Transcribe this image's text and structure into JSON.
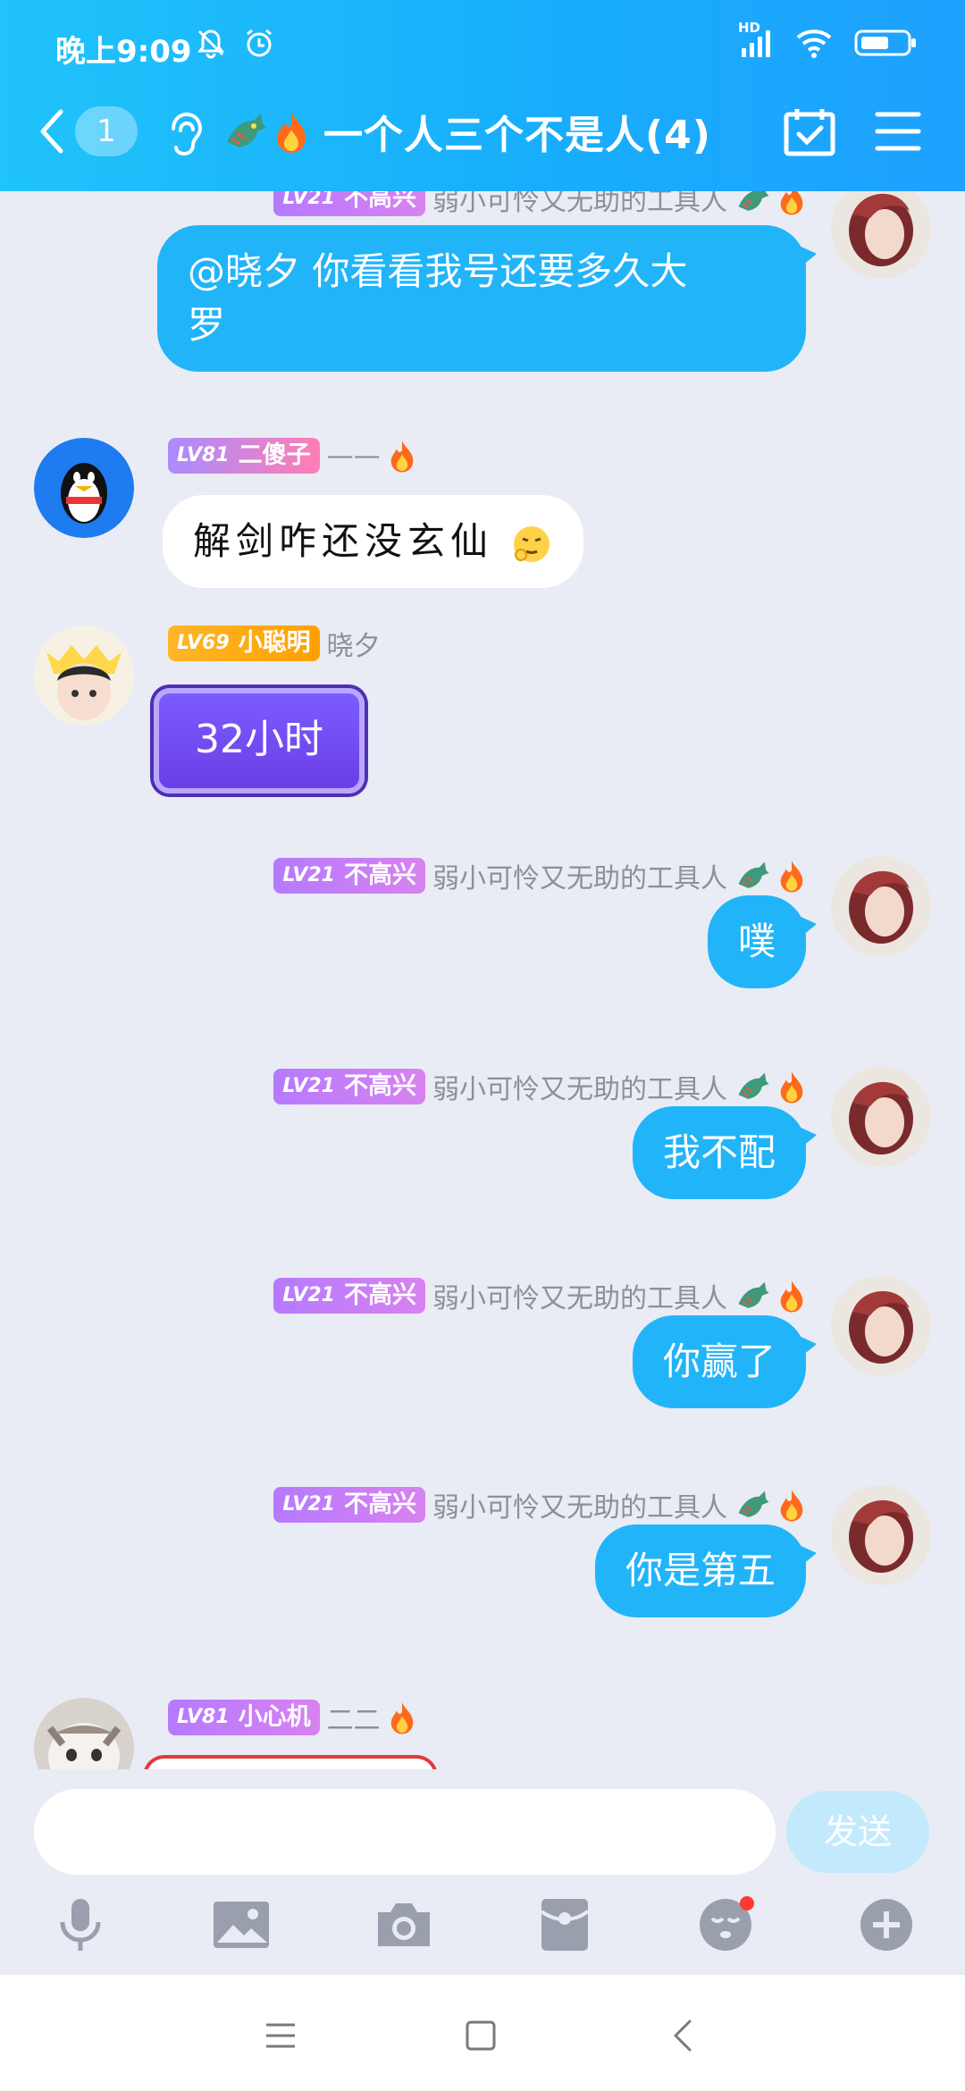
{
  "status_bar": {
    "time": "晚上9:09",
    "hd": "HD"
  },
  "title_bar": {
    "unread_count": "1",
    "title": "一个人三个不是人(4)"
  },
  "messages": [
    {
      "direction": "out",
      "level": "LV21",
      "title_badge": "不高兴",
      "nickname": "弱小可怜又无助的工具人",
      "text": "@晓夕 你看看我号还要多久大\n罗"
    },
    {
      "direction": "in",
      "level": "LV81",
      "title_badge": "二傻子",
      "nickname": "——",
      "text": "解剑咋还没玄仙"
    },
    {
      "direction": "in",
      "level": "LV69",
      "title_badge": "小聪明",
      "nickname": "晓夕",
      "text": "32小时"
    },
    {
      "direction": "out",
      "level": "LV21",
      "title_badge": "不高兴",
      "nickname": "弱小可怜又无助的工具人",
      "text": "噗"
    },
    {
      "direction": "out",
      "level": "LV21",
      "title_badge": "不高兴",
      "nickname": "弱小可怜又无助的工具人",
      "text": "我不配"
    },
    {
      "direction": "out",
      "level": "LV21",
      "title_badge": "不高兴",
      "nickname": "弱小可怜又无助的工具人",
      "text": "你赢了"
    },
    {
      "direction": "out",
      "level": "LV21",
      "title_badge": "不高兴",
      "nickname": "弱小可怜又无助的工具人",
      "text": "你是第五"
    },
    {
      "direction": "in",
      "level": "LV81",
      "title_badge": "小心机",
      "nickname": "二二",
      "text": ""
    }
  ],
  "input": {
    "value": "",
    "send_label": "发送"
  },
  "toolbar": {
    "items": [
      "microphone-icon",
      "image-icon",
      "camera-icon",
      "red-packet-icon",
      "emoji-icon",
      "plus-icon"
    ]
  },
  "colors": {
    "header": "#1eb2fb",
    "bubble_out": "#22b4f9",
    "bubble_in": "#ffffff",
    "background": "#e9ecf4",
    "send_disabled": "#c3eafc"
  }
}
